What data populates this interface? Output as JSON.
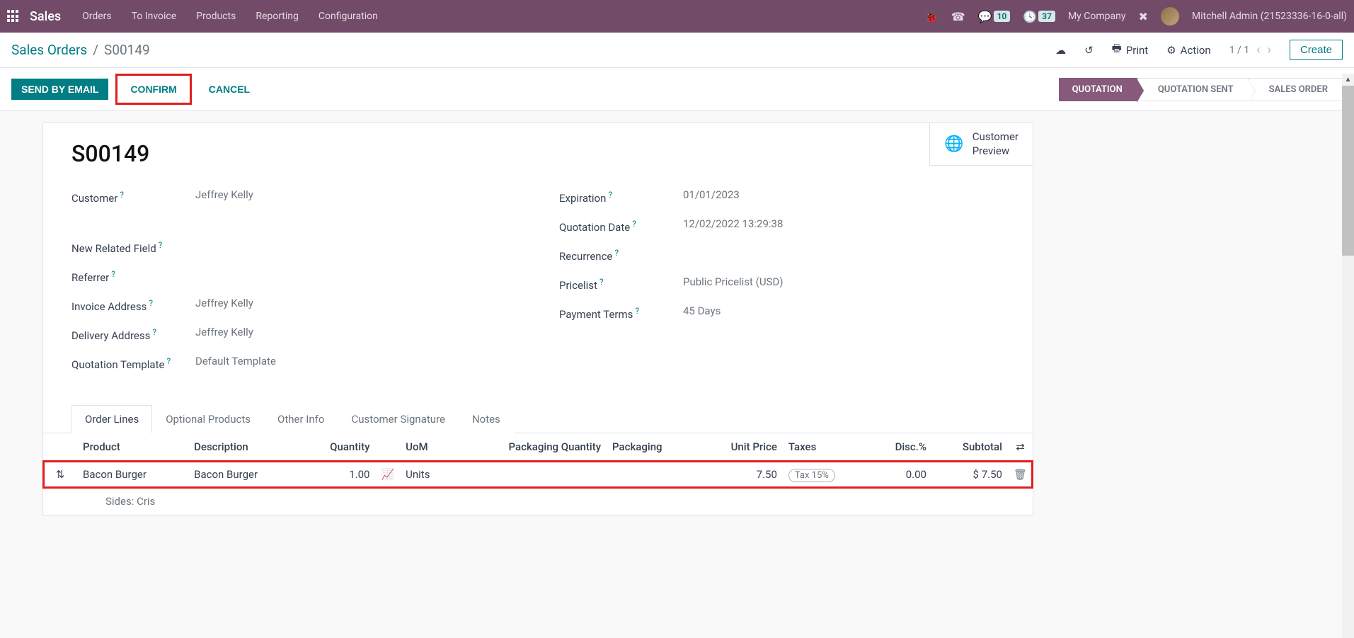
{
  "nav": {
    "brand": "Sales",
    "menu": [
      "Orders",
      "To Invoice",
      "Products",
      "Reporting",
      "Configuration"
    ],
    "messages_badge": "10",
    "activities_badge": "37",
    "company": "My Company",
    "user": "Mitchell Admin (21523336-16-0-all)"
  },
  "breadcrumb": {
    "parent": "Sales Orders",
    "current": "S00149"
  },
  "controls": {
    "print": "Print",
    "action": "Action",
    "pager": "1 / 1",
    "create": "Create"
  },
  "actions": {
    "send_email": "SEND BY EMAIL",
    "confirm": "CONFIRM",
    "cancel": "CANCEL"
  },
  "status": {
    "quotation": "QUOTATION",
    "quotation_sent": "QUOTATION SENT",
    "sales_order": "SALES ORDER"
  },
  "preview": {
    "line1": "Customer",
    "line2": "Preview"
  },
  "order": {
    "name": "S00149",
    "left": {
      "customer_label": "Customer",
      "customer": "Jeffrey Kelly",
      "new_related_label": "New Related Field",
      "new_related": "",
      "referrer_label": "Referrer",
      "referrer": "",
      "invoice_addr_label": "Invoice Address",
      "invoice_addr": "Jeffrey Kelly",
      "delivery_addr_label": "Delivery Address",
      "delivery_addr": "Jeffrey Kelly",
      "quote_tmpl_label": "Quotation Template",
      "quote_tmpl": "Default Template"
    },
    "right": {
      "expiration_label": "Expiration",
      "expiration": "01/01/2023",
      "quote_date_label": "Quotation Date",
      "quote_date": "12/02/2022 13:29:38",
      "recurrence_label": "Recurrence",
      "recurrence": "",
      "pricelist_label": "Pricelist",
      "pricelist": "Public Pricelist (USD)",
      "payment_terms_label": "Payment Terms",
      "payment_terms": "45 Days"
    }
  },
  "tabs": {
    "order_lines": "Order Lines",
    "optional": "Optional Products",
    "other": "Other Info",
    "signature": "Customer Signature",
    "notes": "Notes"
  },
  "columns": {
    "product": "Product",
    "description": "Description",
    "quantity": "Quantity",
    "uom": "UoM",
    "pkg_qty": "Packaging Quantity",
    "packaging": "Packaging",
    "unit_price": "Unit Price",
    "taxes": "Taxes",
    "disc": "Disc.%",
    "subtotal": "Subtotal"
  },
  "lines": [
    {
      "product": "Bacon Burger",
      "description": "Bacon Burger",
      "quantity": "1.00",
      "uom": "Units",
      "pkg_qty": "",
      "packaging": "",
      "unit_price": "7.50",
      "tax": "Tax 15%",
      "disc": "0.00",
      "subtotal": "$ 7.50"
    }
  ],
  "section": "Sides: Cris"
}
